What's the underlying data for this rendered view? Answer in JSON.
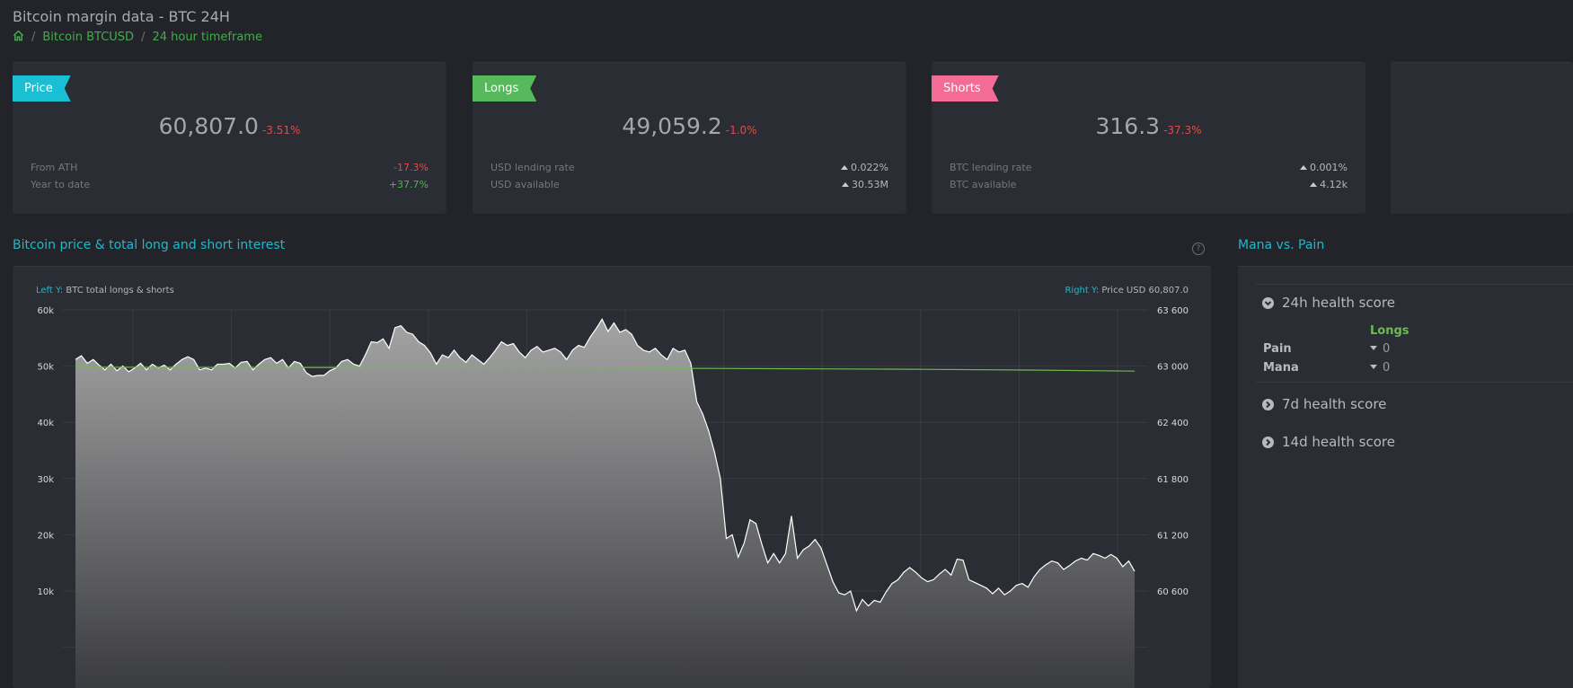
{
  "header": {
    "title": "Bitcoin margin data - BTC 24H",
    "breadcrumb": [
      "Bitcoin BTCUSD",
      "24 hour timeframe"
    ]
  },
  "cards": [
    {
      "tag": "Price",
      "color": "#1bbfd3",
      "value": "60,807.0",
      "change": "-3.51%",
      "rows": [
        {
          "label": "From ATH",
          "value": "-17.3%",
          "color": "#e24b4b"
        },
        {
          "label": "Year to date",
          "value": "+37.7%",
          "color": "#4cb84f"
        }
      ]
    },
    {
      "tag": "Longs",
      "color": "#56b95c",
      "value": "49,059.2",
      "change": "-1.0%",
      "rows": [
        {
          "label": "USD lending rate",
          "value": "0.022%",
          "trend": "up"
        },
        {
          "label": "USD available",
          "value": "30.53M",
          "trend": "up"
        }
      ]
    },
    {
      "tag": "Shorts",
      "color": "#f26c95",
      "value": "316.3",
      "change": "-37.3%",
      "rows": [
        {
          "label": "BTC lending rate",
          "value": "0.001%",
          "trend": "up"
        },
        {
          "label": "BTC available",
          "value": "4.12k",
          "trend": "up"
        }
      ]
    }
  ],
  "chart_section": {
    "title": "Bitcoin price & total long and short interest",
    "help": "?"
  },
  "chart_data": {
    "type": "area",
    "left_label_prefix": "Left Y:",
    "left_label": "BTC total longs & shorts",
    "right_label_prefix": "Right Y:",
    "right_label": "Price USD 60,807.0",
    "left_ticks": [
      "60k",
      "50k",
      "40k",
      "30k",
      "20k",
      "10k"
    ],
    "left_tick_values": [
      60000,
      50000,
      40000,
      30000,
      20000,
      10000
    ],
    "left_ylim": [
      0,
      60000
    ],
    "right_ticks": [
      "63 600",
      "63 000",
      "62 400",
      "61 800",
      "61 200",
      "60 600"
    ],
    "right_tick_values": [
      63600,
      63000,
      62400,
      61800,
      61200,
      60600
    ],
    "right_ylim": [
      60000,
      63600
    ],
    "grid": true,
    "series": [
      {
        "name": "Price USD",
        "axis": "right",
        "color": "#ffffff",
        "values": [
          63070,
          63110,
          63030,
          63070,
          63010,
          62960,
          63020,
          62950,
          63000,
          62940,
          62980,
          63030,
          62960,
          63020,
          62980,
          63010,
          62960,
          63020,
          63070,
          63100,
          63070,
          62960,
          62980,
          62960,
          63020,
          63020,
          63030,
          62980,
          63040,
          63050,
          62960,
          63020,
          63070,
          63090,
          63030,
          63070,
          62980,
          63050,
          63030,
          62930,
          62890,
          62900,
          62900,
          62950,
          62980,
          63050,
          63070,
          63020,
          63000,
          63120,
          63260,
          63250,
          63290,
          63190,
          63410,
          63430,
          63360,
          63340,
          63260,
          63220,
          63140,
          63020,
          63120,
          63090,
          63170,
          63090,
          63040,
          63120,
          63070,
          63020,
          63090,
          63170,
          63260,
          63220,
          63240,
          63150,
          63090,
          63170,
          63210,
          63150,
          63170,
          63190,
          63150,
          63070,
          63170,
          63220,
          63200,
          63310,
          63400,
          63500,
          63370,
          63460,
          63360,
          63390,
          63340,
          63220,
          63170,
          63150,
          63190,
          63120,
          63070,
          63190,
          63150,
          63170,
          63030,
          62620,
          62490,
          62310,
          62080,
          61800,
          61160,
          61200,
          60960,
          61110,
          61360,
          61320,
          61100,
          60900,
          61000,
          60900,
          61000,
          61400,
          60950,
          61040,
          61080,
          61150,
          61060,
          60880,
          60700,
          60580,
          60560,
          60600,
          60390,
          60510,
          60440,
          60500,
          60480,
          60590,
          60680,
          60720,
          60800,
          60850,
          60800,
          60740,
          60700,
          60720,
          60780,
          60830,
          60770,
          60940,
          60930,
          60720,
          60690,
          60660,
          60630,
          60570,
          60630,
          60560,
          60600,
          60660,
          60680,
          60640,
          60750,
          60830,
          60880,
          60920,
          60900,
          60830,
          60870,
          60920,
          60950,
          60930,
          61000,
          60980,
          60950,
          60990,
          60950,
          60860,
          60920,
          60810
        ]
      },
      {
        "name": "BTC total longs",
        "axis": "left",
        "color": "#6dbb4f",
        "values": [
          49800,
          49780,
          49760,
          49740,
          49700,
          49650,
          49580,
          49500,
          49420,
          49300,
          49100
        ]
      }
    ]
  },
  "mana": {
    "title": "Mana vs. Pain",
    "sections": [
      "24h health score",
      "7d health score",
      "14d health score"
    ],
    "column": "Longs",
    "rows": [
      {
        "label": "Pain",
        "value": "0"
      },
      {
        "label": "Mana",
        "value": "0"
      }
    ]
  }
}
